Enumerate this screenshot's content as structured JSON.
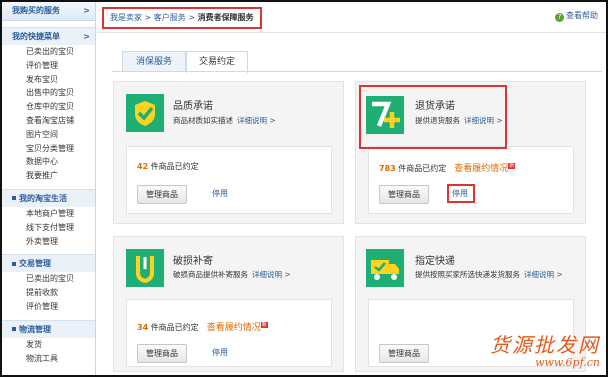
{
  "sidebar": {
    "top": {
      "label": "我购买的服务",
      "arrow": ">"
    },
    "sections": [
      {
        "title": "我的快捷菜单",
        "arrow": ">",
        "items": [
          "已卖出的宝贝",
          "评价管理",
          "发布宝贝",
          "出售中的宝贝",
          "仓库中的宝贝",
          "查看淘宝店铺",
          "图片空间",
          "宝贝分类管理",
          "数据中心",
          "我要推广"
        ]
      },
      {
        "title": "我的淘宝生活",
        "arrow": "",
        "items": [
          "本地商户管理",
          "线下支付管理",
          "外卖管理"
        ]
      },
      {
        "title": "交易管理",
        "arrow": "",
        "items": [
          "已卖出的宝贝",
          "提前收款",
          "评价管理"
        ]
      },
      {
        "title": "物流管理",
        "arrow": "",
        "items": [
          "发货",
          "物流工具"
        ]
      }
    ]
  },
  "breadcrumb": {
    "items": [
      "我是卖家",
      "客户服务"
    ],
    "sep": ">",
    "current": "消费者保障服务"
  },
  "help": {
    "icon": "?",
    "label": "查看帮助"
  },
  "tabs": [
    {
      "label": "消保服务"
    },
    {
      "label": "交易约定"
    }
  ],
  "cards": [
    {
      "title": "品质承诺",
      "desc": "商品材质如实描述",
      "link": "详细说明 >",
      "count": "42",
      "count_suffix": "件商品已约定",
      "perf": "",
      "perf_badge": "",
      "manage": "管理商品",
      "stop": "停用",
      "icon_color": "#1fae74"
    },
    {
      "title": "退货承诺",
      "desc": "提供退货服务",
      "link": "详细说明 >",
      "count": "783",
      "count_suffix": "件商品已约定",
      "perf": "查看履约情况",
      "perf_badge": "新",
      "manage": "管理商品",
      "stop": "停用",
      "icon_color": "#1fae74"
    },
    {
      "title": "破损补寄",
      "desc": "破损商品提供补寄服务",
      "link": "详细说明 >",
      "count": "34",
      "count_suffix": "件商品已约定",
      "perf": "查看履约情况",
      "perf_badge": "新",
      "manage": "管理商品",
      "stop": "停用",
      "icon_color": "#1fae74"
    },
    {
      "title": "指定快递",
      "desc": "提供按照买家所选快递发货服务",
      "link": "详细说明 >",
      "count": "",
      "count_suffix": "",
      "perf": "",
      "perf_badge": "",
      "manage": "管理商品",
      "stop": "",
      "icon_color": "#1fae74"
    }
  ],
  "watermark": {
    "line1": "货源批发网",
    "line2": "www.6pf.cn"
  }
}
